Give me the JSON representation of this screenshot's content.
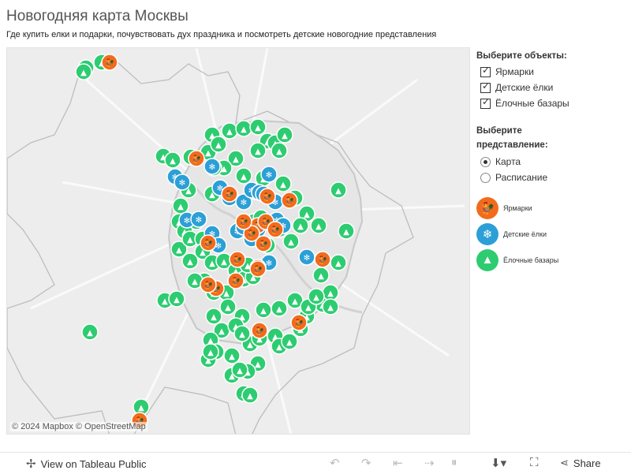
{
  "title": "Новогодняя карта Москвы",
  "subtitle": "Где купить елки и подарки, почувствовать дух праздника и посмотреть детские новогодние представления",
  "map": {
    "attribution": "© 2024 Mapbox  © OpenStreetMap"
  },
  "filters": {
    "objects_header": "Выберите объекты:",
    "objects": [
      {
        "label": "Ярмарки",
        "checked": true
      },
      {
        "label": "Детские ёлки",
        "checked": true
      },
      {
        "label": "Ёлочные базары",
        "checked": true
      }
    ],
    "view_header": "Выберите представление:",
    "views": [
      {
        "label": "Карта",
        "selected": true
      },
      {
        "label": "Расписание",
        "selected": false
      }
    ]
  },
  "legend": [
    {
      "label": "Ярмарки",
      "color": "#f26b1d",
      "icon": "rooster-icon"
    },
    {
      "label": "Детские ёлки",
      "color": "#2c9fd6",
      "icon": "snowflake-icon"
    },
    {
      "label": "Ёлочные базары",
      "color": "#2ecc71",
      "icon": "fir-tree-icon"
    }
  ],
  "footer": {
    "view_on_tableau": "View on Tableau Public",
    "share": "Share"
  }
}
